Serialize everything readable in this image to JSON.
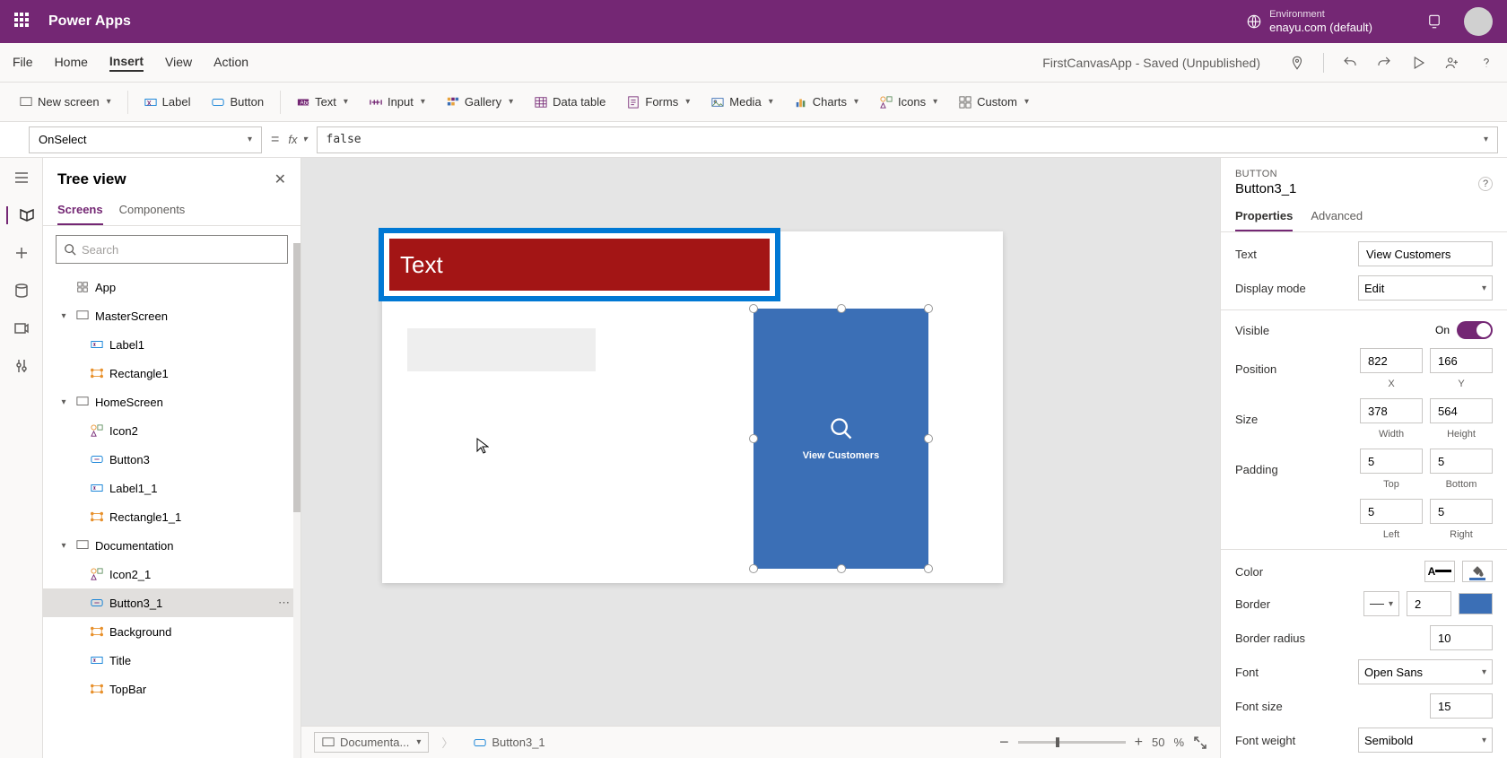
{
  "header": {
    "app_name": "Power Apps",
    "env_label": "Environment",
    "env_name": "enayu.com (default)"
  },
  "menu": {
    "items": [
      "File",
      "Home",
      "Insert",
      "View",
      "Action"
    ],
    "active": "Insert",
    "doc_title": "FirstCanvasApp - Saved (Unpublished)"
  },
  "ribbon": {
    "new_screen": "New screen",
    "label": "Label",
    "button": "Button",
    "text": "Text",
    "input": "Input",
    "gallery": "Gallery",
    "data_table": "Data table",
    "forms": "Forms",
    "media": "Media",
    "charts": "Charts",
    "icons": "Icons",
    "custom": "Custom"
  },
  "formula": {
    "property": "OnSelect",
    "fx": "fx",
    "value": "false"
  },
  "tree": {
    "title": "Tree view",
    "tabs": [
      "Screens",
      "Components"
    ],
    "search_placeholder": "Search",
    "nodes": [
      {
        "label": "App",
        "indent": 1,
        "icon": "app",
        "expand": ""
      },
      {
        "label": "MasterScreen",
        "indent": 1,
        "icon": "screen",
        "expand": "v"
      },
      {
        "label": "Label1",
        "indent": 2,
        "icon": "label",
        "expand": ""
      },
      {
        "label": "Rectangle1",
        "indent": 2,
        "icon": "rect",
        "expand": ""
      },
      {
        "label": "HomeScreen",
        "indent": 1,
        "icon": "screen",
        "expand": "v"
      },
      {
        "label": "Icon2",
        "indent": 2,
        "icon": "icons",
        "expand": ""
      },
      {
        "label": "Button3",
        "indent": 2,
        "icon": "button",
        "expand": ""
      },
      {
        "label": "Label1_1",
        "indent": 2,
        "icon": "label",
        "expand": ""
      },
      {
        "label": "Rectangle1_1",
        "indent": 2,
        "icon": "rect",
        "expand": ""
      },
      {
        "label": "Documentation",
        "indent": 1,
        "icon": "screen",
        "expand": "v"
      },
      {
        "label": "Icon2_1",
        "indent": 2,
        "icon": "icons",
        "expand": ""
      },
      {
        "label": "Button3_1",
        "indent": 2,
        "icon": "button",
        "expand": "",
        "selected": true
      },
      {
        "label": "Background",
        "indent": 2,
        "icon": "rect",
        "expand": ""
      },
      {
        "label": "Title",
        "indent": 2,
        "icon": "label",
        "expand": ""
      },
      {
        "label": "TopBar",
        "indent": 2,
        "icon": "rect",
        "expand": ""
      }
    ]
  },
  "canvas": {
    "banner_text": "Text",
    "button_text": "View Customers"
  },
  "status": {
    "crumb_screen": "Documenta...",
    "crumb_sel": "Button3_1",
    "zoom": "50",
    "zoom_unit": "%"
  },
  "props": {
    "type": "BUTTON",
    "name": "Button3_1",
    "tabs": [
      "Properties",
      "Advanced"
    ],
    "text_lbl": "Text",
    "text_val": "View Customers",
    "display_lbl": "Display mode",
    "display_val": "Edit",
    "visible_lbl": "Visible",
    "visible_val": "On",
    "position_lbl": "Position",
    "pos_x": "822",
    "pos_y": "166",
    "x_lbl": "X",
    "y_lbl": "Y",
    "size_lbl": "Size",
    "width": "378",
    "height": "564",
    "w_lbl": "Width",
    "h_lbl": "Height",
    "padding_lbl": "Padding",
    "pad_t": "5",
    "pad_b": "5",
    "pad_l": "5",
    "pad_r": "5",
    "t_lbl": "Top",
    "b_lbl": "Bottom",
    "l_lbl": "Left",
    "r_lbl": "Right",
    "color_lbl": "Color",
    "border_lbl": "Border",
    "border_val": "2",
    "radius_lbl": "Border radius",
    "radius_val": "10",
    "font_lbl": "Font",
    "font_val": "Open Sans",
    "fsize_lbl": "Font size",
    "fsize_val": "15",
    "fweight_lbl": "Font weight",
    "fweight_val": "Semibold"
  }
}
